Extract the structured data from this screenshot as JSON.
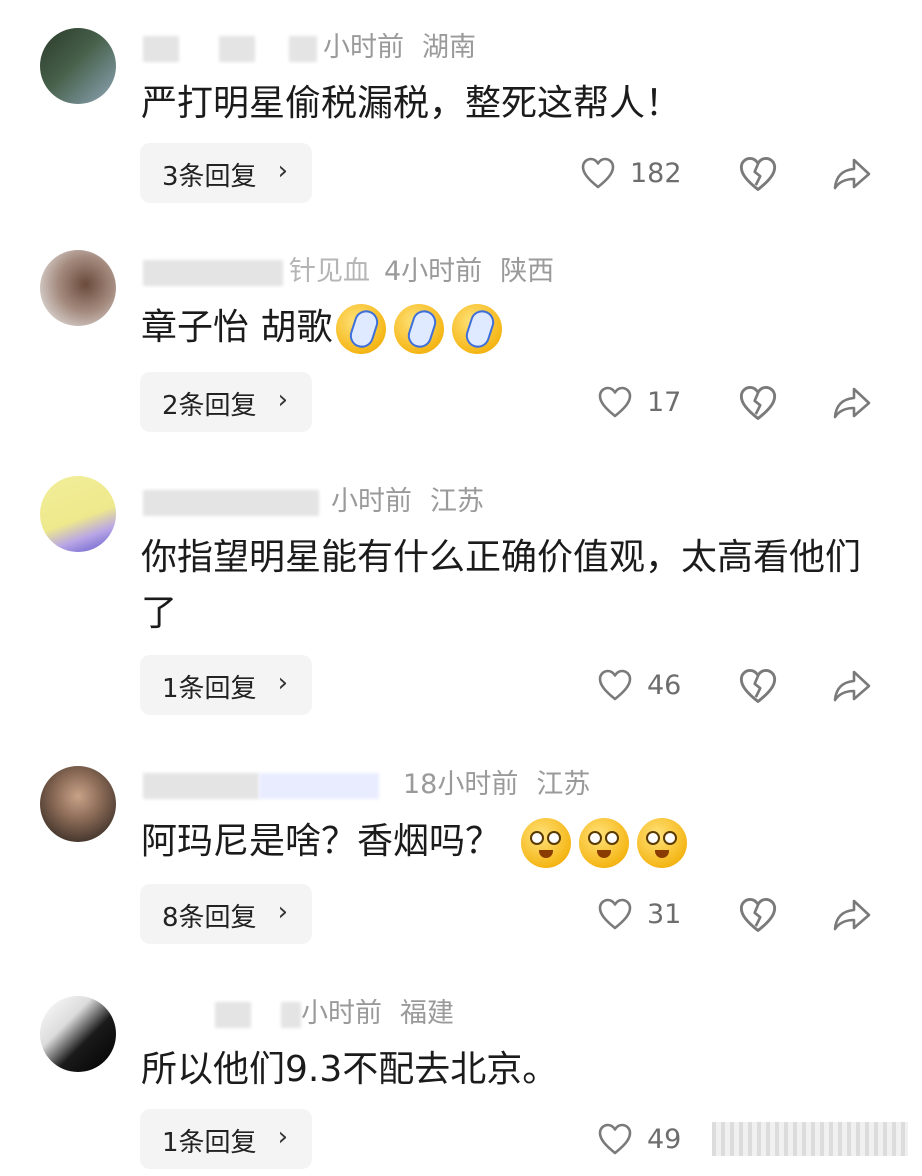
{
  "comments": [
    {
      "meta": {
        "name": "",
        "time": "小时前",
        "location": "湖南"
      },
      "text": "严打明星偷税漏税，整死这帮人！",
      "emoji_icons": [],
      "reply_label": "3条回复",
      "likes": "182"
    },
    {
      "meta": {
        "name": "针见血",
        "time": "4小时前",
        "location": "陕西"
      },
      "text": "章子怡 胡歌",
      "emoji_icons": [
        "crying-flip-flop-emoji",
        "crying-flip-flop-emoji",
        "crying-flip-flop-emoji"
      ],
      "reply_label": "2条回复",
      "likes": "17"
    },
    {
      "meta": {
        "name": "",
        "time": "小时前",
        "location": "江苏"
      },
      "text": "你指望明星能有什么正确价值观，太高看他们了",
      "emoji_icons": [],
      "reply_label": "1条回复",
      "likes": "46"
    },
    {
      "meta": {
        "name": "",
        "time": "18小时前",
        "location": "江苏"
      },
      "text": "阿玛尼是啥？香烟吗？",
      "emoji_icons": [
        "hush-emoji",
        "hush-emoji",
        "hush-emoji"
      ],
      "reply_label": "8条回复",
      "likes": "31"
    },
    {
      "meta": {
        "name": "",
        "time": "小时前",
        "location": "福建"
      },
      "text": "所以他们9.3不配去北京。",
      "emoji_icons": [],
      "reply_label": "1条回复",
      "likes": "49"
    }
  ],
  "icons": {
    "like": "heart-outline-icon",
    "dislike": "broken-heart-icon",
    "share": "share-arrow-icon",
    "chevron": "chevron-right-icon"
  },
  "chevron_glyph": "›",
  "colors": {
    "meta_text": "#9a9a9a",
    "reply_bg": "#f4f4f4",
    "icon_stroke": "#7a7a7a"
  }
}
